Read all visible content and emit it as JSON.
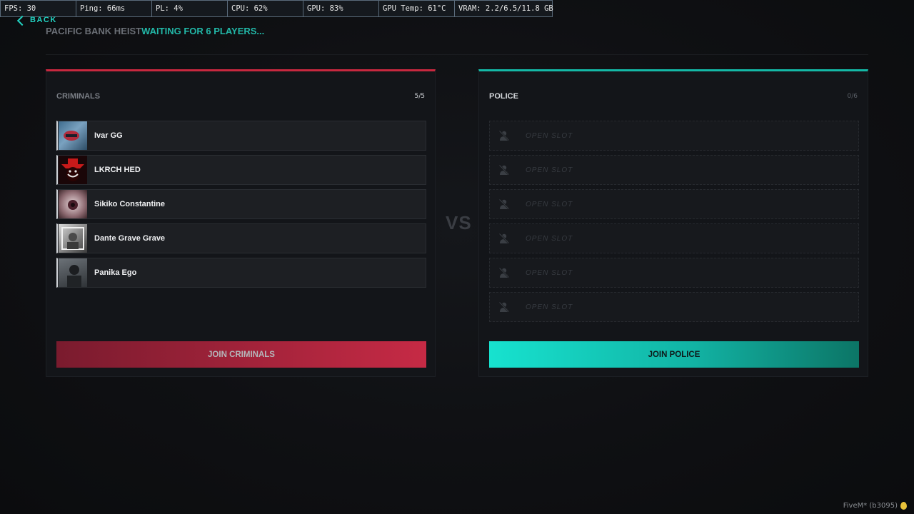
{
  "perf": {
    "fps": "FPS: 30",
    "ping": "Ping: 66ms",
    "pl": "PL: 4%",
    "cpu": "CPU: 62%",
    "gpu": "GPU: 83%",
    "gpu_temp": "GPU Temp: 61°C",
    "vram": "VRAM: 2.2/6.5/11.8 GB"
  },
  "nav": {
    "back_label": "BACK"
  },
  "header": {
    "heist_name": "PACIFIC BANK HEIST",
    "status": "WAITING FOR 6 PLAYERS..."
  },
  "criminals": {
    "title": "CRIMINALS",
    "count": "5/5",
    "accent": "#c8283f",
    "players": [
      {
        "name": "Ivar GG"
      },
      {
        "name": "LKRCH HED"
      },
      {
        "name": "Sikiko Constantine"
      },
      {
        "name": "Dante Grave Grave"
      },
      {
        "name": "Panika Ego"
      }
    ],
    "join_label": "JOIN CRIMINALS"
  },
  "vs_label": "VS",
  "police": {
    "title": "POLICE",
    "count": "0/6",
    "accent": "#14b8a6",
    "open_slot_label": "OPEN SLOT",
    "open_slots": 6,
    "join_label": "JOIN POLICE"
  },
  "footer": {
    "build": "FiveM* (b3095)"
  }
}
